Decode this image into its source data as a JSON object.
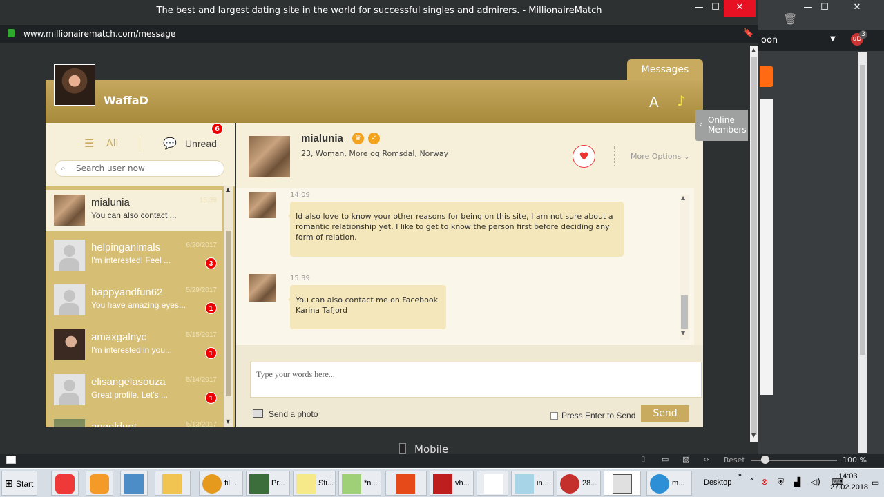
{
  "window": {
    "title": "The best and largest dating site in the world for successful singles and admirers. - MillionaireMatch",
    "url": "www.millionairematch.com/message",
    "minimize": "—",
    "maximize": "☐",
    "close": "✕"
  },
  "bg_window": {
    "text": "oon",
    "badge": "3"
  },
  "app": {
    "tab": "Messages",
    "username": "WaffaD",
    "font_icon": "A",
    "music_icon": "♪",
    "filters": {
      "all": "All",
      "unread": "Unread",
      "unread_count": "6"
    },
    "search_placeholder": "Search user now",
    "conversations": [
      {
        "name": "mialunia",
        "preview": "You can also contact ...",
        "date": "15:39",
        "badge": ""
      },
      {
        "name": "helpinganimals",
        "preview": "I'm interested! Feel ...",
        "date": "6/20/2017",
        "badge": "3"
      },
      {
        "name": "happyandfun62",
        "preview": "You have amazing eyes...",
        "date": "5/29/2017",
        "badge": "1"
      },
      {
        "name": "amaxgalnyc",
        "preview": "I'm interested in you...",
        "date": "5/15/2017",
        "badge": "1"
      },
      {
        "name": "elisangelasouza",
        "preview": "Great profile. Let's ...",
        "date": "5/14/2017",
        "badge": "1"
      },
      {
        "name": "angelduet",
        "preview": "",
        "date": "5/13/2017",
        "badge": ""
      }
    ],
    "profile": {
      "name": "mialunia",
      "info": "23, Woman, More og Romsdal, Norway",
      "more_options": "More Options"
    },
    "messages": [
      {
        "time": "14:09",
        "text": "Id also love to know your other reasons for being on this site, I am not sure about a romantic relationship yet, I like to get to know the person first before deciding any form of relation."
      },
      {
        "time": "15:39",
        "text": "You can also contact me on Facebook Karina Tafjord"
      }
    ],
    "input_placeholder": "Type your words here...",
    "send_photo": "Send a photo",
    "press_enter": "Press Enter to Send",
    "send": "Send",
    "online_members": "Online Members"
  },
  "statusbar": {
    "mobile": "Mobile",
    "reset": "Reset",
    "zoom": "100 %"
  },
  "taskbar": {
    "start": "Start",
    "items": [
      "fil...",
      "Pr...",
      "Sti...",
      "*n...",
      "vh...",
      "in...",
      "28..."
    ],
    "app_m": "m...",
    "desktop": "Desktop",
    "time": "14:03",
    "date": "27.02.2018"
  }
}
